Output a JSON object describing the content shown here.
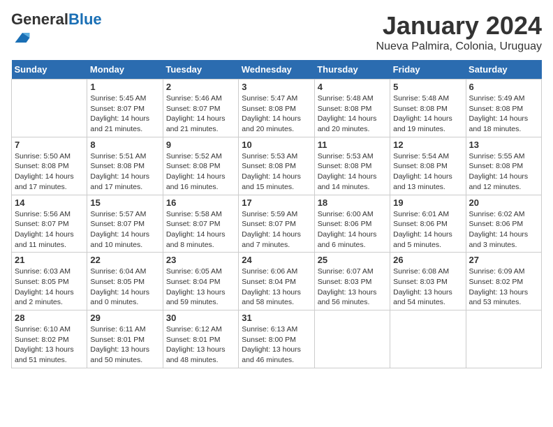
{
  "header": {
    "logo_general": "General",
    "logo_blue": "Blue",
    "month_title": "January 2024",
    "location": "Nueva Palmira, Colonia, Uruguay"
  },
  "weekdays": [
    "Sunday",
    "Monday",
    "Tuesday",
    "Wednesday",
    "Thursday",
    "Friday",
    "Saturday"
  ],
  "weeks": [
    [
      {
        "day": "",
        "sunrise": "",
        "sunset": "",
        "daylight": ""
      },
      {
        "day": "1",
        "sunrise": "Sunrise: 5:45 AM",
        "sunset": "Sunset: 8:07 PM",
        "daylight": "Daylight: 14 hours and 21 minutes."
      },
      {
        "day": "2",
        "sunrise": "Sunrise: 5:46 AM",
        "sunset": "Sunset: 8:07 PM",
        "daylight": "Daylight: 14 hours and 21 minutes."
      },
      {
        "day": "3",
        "sunrise": "Sunrise: 5:47 AM",
        "sunset": "Sunset: 8:08 PM",
        "daylight": "Daylight: 14 hours and 20 minutes."
      },
      {
        "day": "4",
        "sunrise": "Sunrise: 5:48 AM",
        "sunset": "Sunset: 8:08 PM",
        "daylight": "Daylight: 14 hours and 20 minutes."
      },
      {
        "day": "5",
        "sunrise": "Sunrise: 5:48 AM",
        "sunset": "Sunset: 8:08 PM",
        "daylight": "Daylight: 14 hours and 19 minutes."
      },
      {
        "day": "6",
        "sunrise": "Sunrise: 5:49 AM",
        "sunset": "Sunset: 8:08 PM",
        "daylight": "Daylight: 14 hours and 18 minutes."
      }
    ],
    [
      {
        "day": "7",
        "sunrise": "Sunrise: 5:50 AM",
        "sunset": "Sunset: 8:08 PM",
        "daylight": "Daylight: 14 hours and 17 minutes."
      },
      {
        "day": "8",
        "sunrise": "Sunrise: 5:51 AM",
        "sunset": "Sunset: 8:08 PM",
        "daylight": "Daylight: 14 hours and 17 minutes."
      },
      {
        "day": "9",
        "sunrise": "Sunrise: 5:52 AM",
        "sunset": "Sunset: 8:08 PM",
        "daylight": "Daylight: 14 hours and 16 minutes."
      },
      {
        "day": "10",
        "sunrise": "Sunrise: 5:53 AM",
        "sunset": "Sunset: 8:08 PM",
        "daylight": "Daylight: 14 hours and 15 minutes."
      },
      {
        "day": "11",
        "sunrise": "Sunrise: 5:53 AM",
        "sunset": "Sunset: 8:08 PM",
        "daylight": "Daylight: 14 hours and 14 minutes."
      },
      {
        "day": "12",
        "sunrise": "Sunrise: 5:54 AM",
        "sunset": "Sunset: 8:08 PM",
        "daylight": "Daylight: 14 hours and 13 minutes."
      },
      {
        "day": "13",
        "sunrise": "Sunrise: 5:55 AM",
        "sunset": "Sunset: 8:08 PM",
        "daylight": "Daylight: 14 hours and 12 minutes."
      }
    ],
    [
      {
        "day": "14",
        "sunrise": "Sunrise: 5:56 AM",
        "sunset": "Sunset: 8:07 PM",
        "daylight": "Daylight: 14 hours and 11 minutes."
      },
      {
        "day": "15",
        "sunrise": "Sunrise: 5:57 AM",
        "sunset": "Sunset: 8:07 PM",
        "daylight": "Daylight: 14 hours and 10 minutes."
      },
      {
        "day": "16",
        "sunrise": "Sunrise: 5:58 AM",
        "sunset": "Sunset: 8:07 PM",
        "daylight": "Daylight: 14 hours and 8 minutes."
      },
      {
        "day": "17",
        "sunrise": "Sunrise: 5:59 AM",
        "sunset": "Sunset: 8:07 PM",
        "daylight": "Daylight: 14 hours and 7 minutes."
      },
      {
        "day": "18",
        "sunrise": "Sunrise: 6:00 AM",
        "sunset": "Sunset: 8:06 PM",
        "daylight": "Daylight: 14 hours and 6 minutes."
      },
      {
        "day": "19",
        "sunrise": "Sunrise: 6:01 AM",
        "sunset": "Sunset: 8:06 PM",
        "daylight": "Daylight: 14 hours and 5 minutes."
      },
      {
        "day": "20",
        "sunrise": "Sunrise: 6:02 AM",
        "sunset": "Sunset: 8:06 PM",
        "daylight": "Daylight: 14 hours and 3 minutes."
      }
    ],
    [
      {
        "day": "21",
        "sunrise": "Sunrise: 6:03 AM",
        "sunset": "Sunset: 8:05 PM",
        "daylight": "Daylight: 14 hours and 2 minutes."
      },
      {
        "day": "22",
        "sunrise": "Sunrise: 6:04 AM",
        "sunset": "Sunset: 8:05 PM",
        "daylight": "Daylight: 14 hours and 0 minutes."
      },
      {
        "day": "23",
        "sunrise": "Sunrise: 6:05 AM",
        "sunset": "Sunset: 8:04 PM",
        "daylight": "Daylight: 13 hours and 59 minutes."
      },
      {
        "day": "24",
        "sunrise": "Sunrise: 6:06 AM",
        "sunset": "Sunset: 8:04 PM",
        "daylight": "Daylight: 13 hours and 58 minutes."
      },
      {
        "day": "25",
        "sunrise": "Sunrise: 6:07 AM",
        "sunset": "Sunset: 8:03 PM",
        "daylight": "Daylight: 13 hours and 56 minutes."
      },
      {
        "day": "26",
        "sunrise": "Sunrise: 6:08 AM",
        "sunset": "Sunset: 8:03 PM",
        "daylight": "Daylight: 13 hours and 54 minutes."
      },
      {
        "day": "27",
        "sunrise": "Sunrise: 6:09 AM",
        "sunset": "Sunset: 8:02 PM",
        "daylight": "Daylight: 13 hours and 53 minutes."
      }
    ],
    [
      {
        "day": "28",
        "sunrise": "Sunrise: 6:10 AM",
        "sunset": "Sunset: 8:02 PM",
        "daylight": "Daylight: 13 hours and 51 minutes."
      },
      {
        "day": "29",
        "sunrise": "Sunrise: 6:11 AM",
        "sunset": "Sunset: 8:01 PM",
        "daylight": "Daylight: 13 hours and 50 minutes."
      },
      {
        "day": "30",
        "sunrise": "Sunrise: 6:12 AM",
        "sunset": "Sunset: 8:01 PM",
        "daylight": "Daylight: 13 hours and 48 minutes."
      },
      {
        "day": "31",
        "sunrise": "Sunrise: 6:13 AM",
        "sunset": "Sunset: 8:00 PM",
        "daylight": "Daylight: 13 hours and 46 minutes."
      },
      {
        "day": "",
        "sunrise": "",
        "sunset": "",
        "daylight": ""
      },
      {
        "day": "",
        "sunrise": "",
        "sunset": "",
        "daylight": ""
      },
      {
        "day": "",
        "sunrise": "",
        "sunset": "",
        "daylight": ""
      }
    ]
  ]
}
